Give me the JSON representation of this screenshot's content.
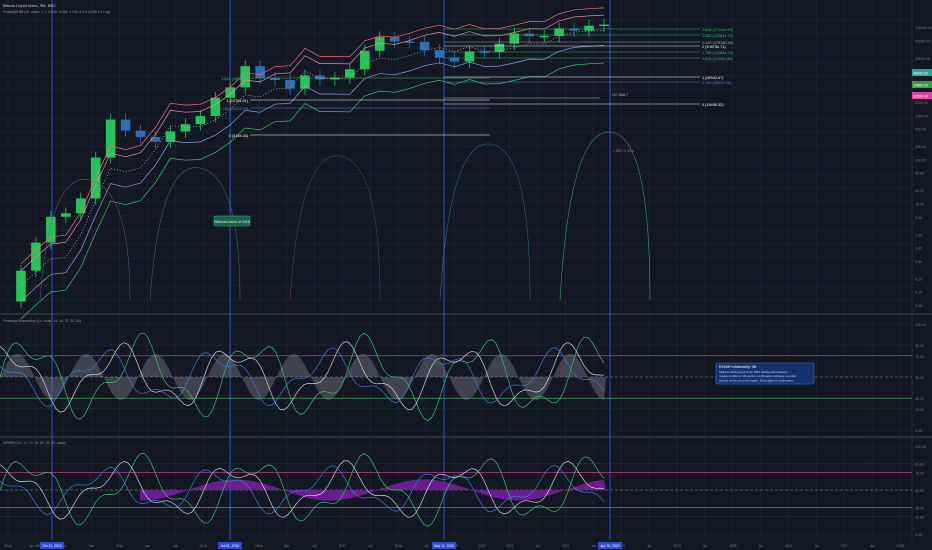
{
  "header": {
    "symbol_line": "Bitcoin Liquid Index, 3M, BNC",
    "indicator_line": "Pinescript BB (20, close, 2, 1, 2.618, 3.618, 4.236, 6 2 6 4.236 4 2 Log)"
  },
  "colors": {
    "bg": "#131722",
    "grid": "#1c2030",
    "candle_up": "#26c35a",
    "candle_down": "#2f6fb5",
    "blue_vline": "#2b4bd8",
    "fib": "#3fc06b"
  },
  "price_axis": {
    "labels": [
      "100000.00",
      "50000.00",
      "20000.00",
      "10000.00",
      "5000.00",
      "2000.00",
      "1000.00",
      "500.00",
      "200.00",
      "100.00",
      "50.00",
      "20.00",
      "10.00",
      "5.00",
      "2.00",
      "1.00",
      "0.50",
      "0.20",
      "0.10",
      "0.05"
    ],
    "badges": [
      {
        "text": "46950.00",
        "color": "#26a69a"
      },
      {
        "text": "39860.00",
        "color": "#2ea043"
      },
      {
        "text": "32500.00",
        "color": "#e040a0"
      }
    ]
  },
  "time_axis": {
    "labels": [
      "2013",
      "Apr 2013",
      "Jul",
      "Oct",
      "2014",
      "Apr",
      "Jul",
      "2015",
      "Jul",
      "2016",
      "Apr",
      "Jul",
      "2017",
      "Jul",
      "2018",
      "Jul",
      "2019",
      "2020",
      "2021",
      "Jul",
      "2022",
      "Jul",
      "2023",
      "Jul",
      "2024",
      "Jul",
      "2025",
      "Jul",
      "2026",
      "Jul",
      "2027",
      "Jul",
      "2028"
    ],
    "highlighted": [
      "Oct 12, 2013",
      "Jul 01, 2016",
      "May 11, 2020",
      "Apr 20, 2024"
    ]
  },
  "fib_levels": [
    {
      "text": "2.618 (171440.65)",
      "color": "#3fc06b"
    },
    {
      "text": "2.382 (142514.75)",
      "color": "#3fc06b"
    },
    {
      "text": "2.102 (129160.39)",
      "color": "#b2b5be"
    },
    {
      "text": "2 (106750.71)",
      "color": "#ffffff"
    },
    {
      "text": "1.786 (122864.36)",
      "color": "#3fc06b"
    },
    {
      "text": "1.618 (113451.88)",
      "color": "#3fc06b"
    },
    {
      "text": "1 (68942.67)",
      "color": "#ffffff"
    },
    {
      "text": "0.786 (53090.46)",
      "color": "#5b8bd8"
    },
    {
      "text": "0 (15495.32)",
      "color": "#ffffff"
    }
  ],
  "cycle_fibs": [
    {
      "text": "1.618 (1907.28)",
      "color": "#3fc06b"
    },
    {
      "text": "1 (19764.51)",
      "color": "#ffffff"
    },
    {
      "text": "0.786 (13203.09)",
      "color": "#5b8bd8"
    },
    {
      "text": "0 (3148.33)",
      "color": "#ffffff"
    }
  ],
  "price_notes": [
    "187.3846.7",
    "-1.285.7-1.95.4"
  ],
  "callout": {
    "text": "Stillness block of 2016"
  },
  "info_box": {
    "title": "RSI/MFI relationship: 3M",
    "body": "Stillness block period of the 2016 halving with sideways market conditions. Momentum confirmation indicates oversold bounce as the next push begins. Expectation is continuation into the halving cycle peak area with RSI and MFI divergence holding."
  },
  "panes": [
    {
      "title": "Pinescript Momentum (14, close, 14, 14, 70, 30, 50)",
      "axis": [
        "100.00",
        "80.00",
        "70.00",
        "50.00",
        "30.00",
        "20.00",
        "0.00"
      ]
    },
    {
      "title": "MFI/RSI (14, 14, 70, 30, 80, 20, 50, close)",
      "axis": [
        "100.00",
        "80.00",
        "70.00",
        "50.00",
        "30.00",
        "20.00",
        "0.00"
      ]
    }
  ],
  "chart_data": {
    "type": "line",
    "title": "Bitcoin Liquid Index, 3M, BNC",
    "yscale": "log",
    "ylim": [
      0.05,
      300000
    ],
    "series": [
      {
        "name": "Close",
        "values": [
          0.06,
          0.3,
          1.3,
          5,
          6,
          13,
          110,
          800,
          450,
          320,
          250,
          430,
          630,
          960,
          2500,
          4300,
          13000,
          7000,
          6300,
          4000,
          8000,
          6500,
          7200,
          11000,
          29000,
          59000,
          47000,
          46000,
          30000,
          20000,
          16500,
          28000,
          27000,
          42000,
          71000,
          62000,
          63000,
          93000,
          83000,
          107000,
          114000
        ]
      }
    ]
  }
}
